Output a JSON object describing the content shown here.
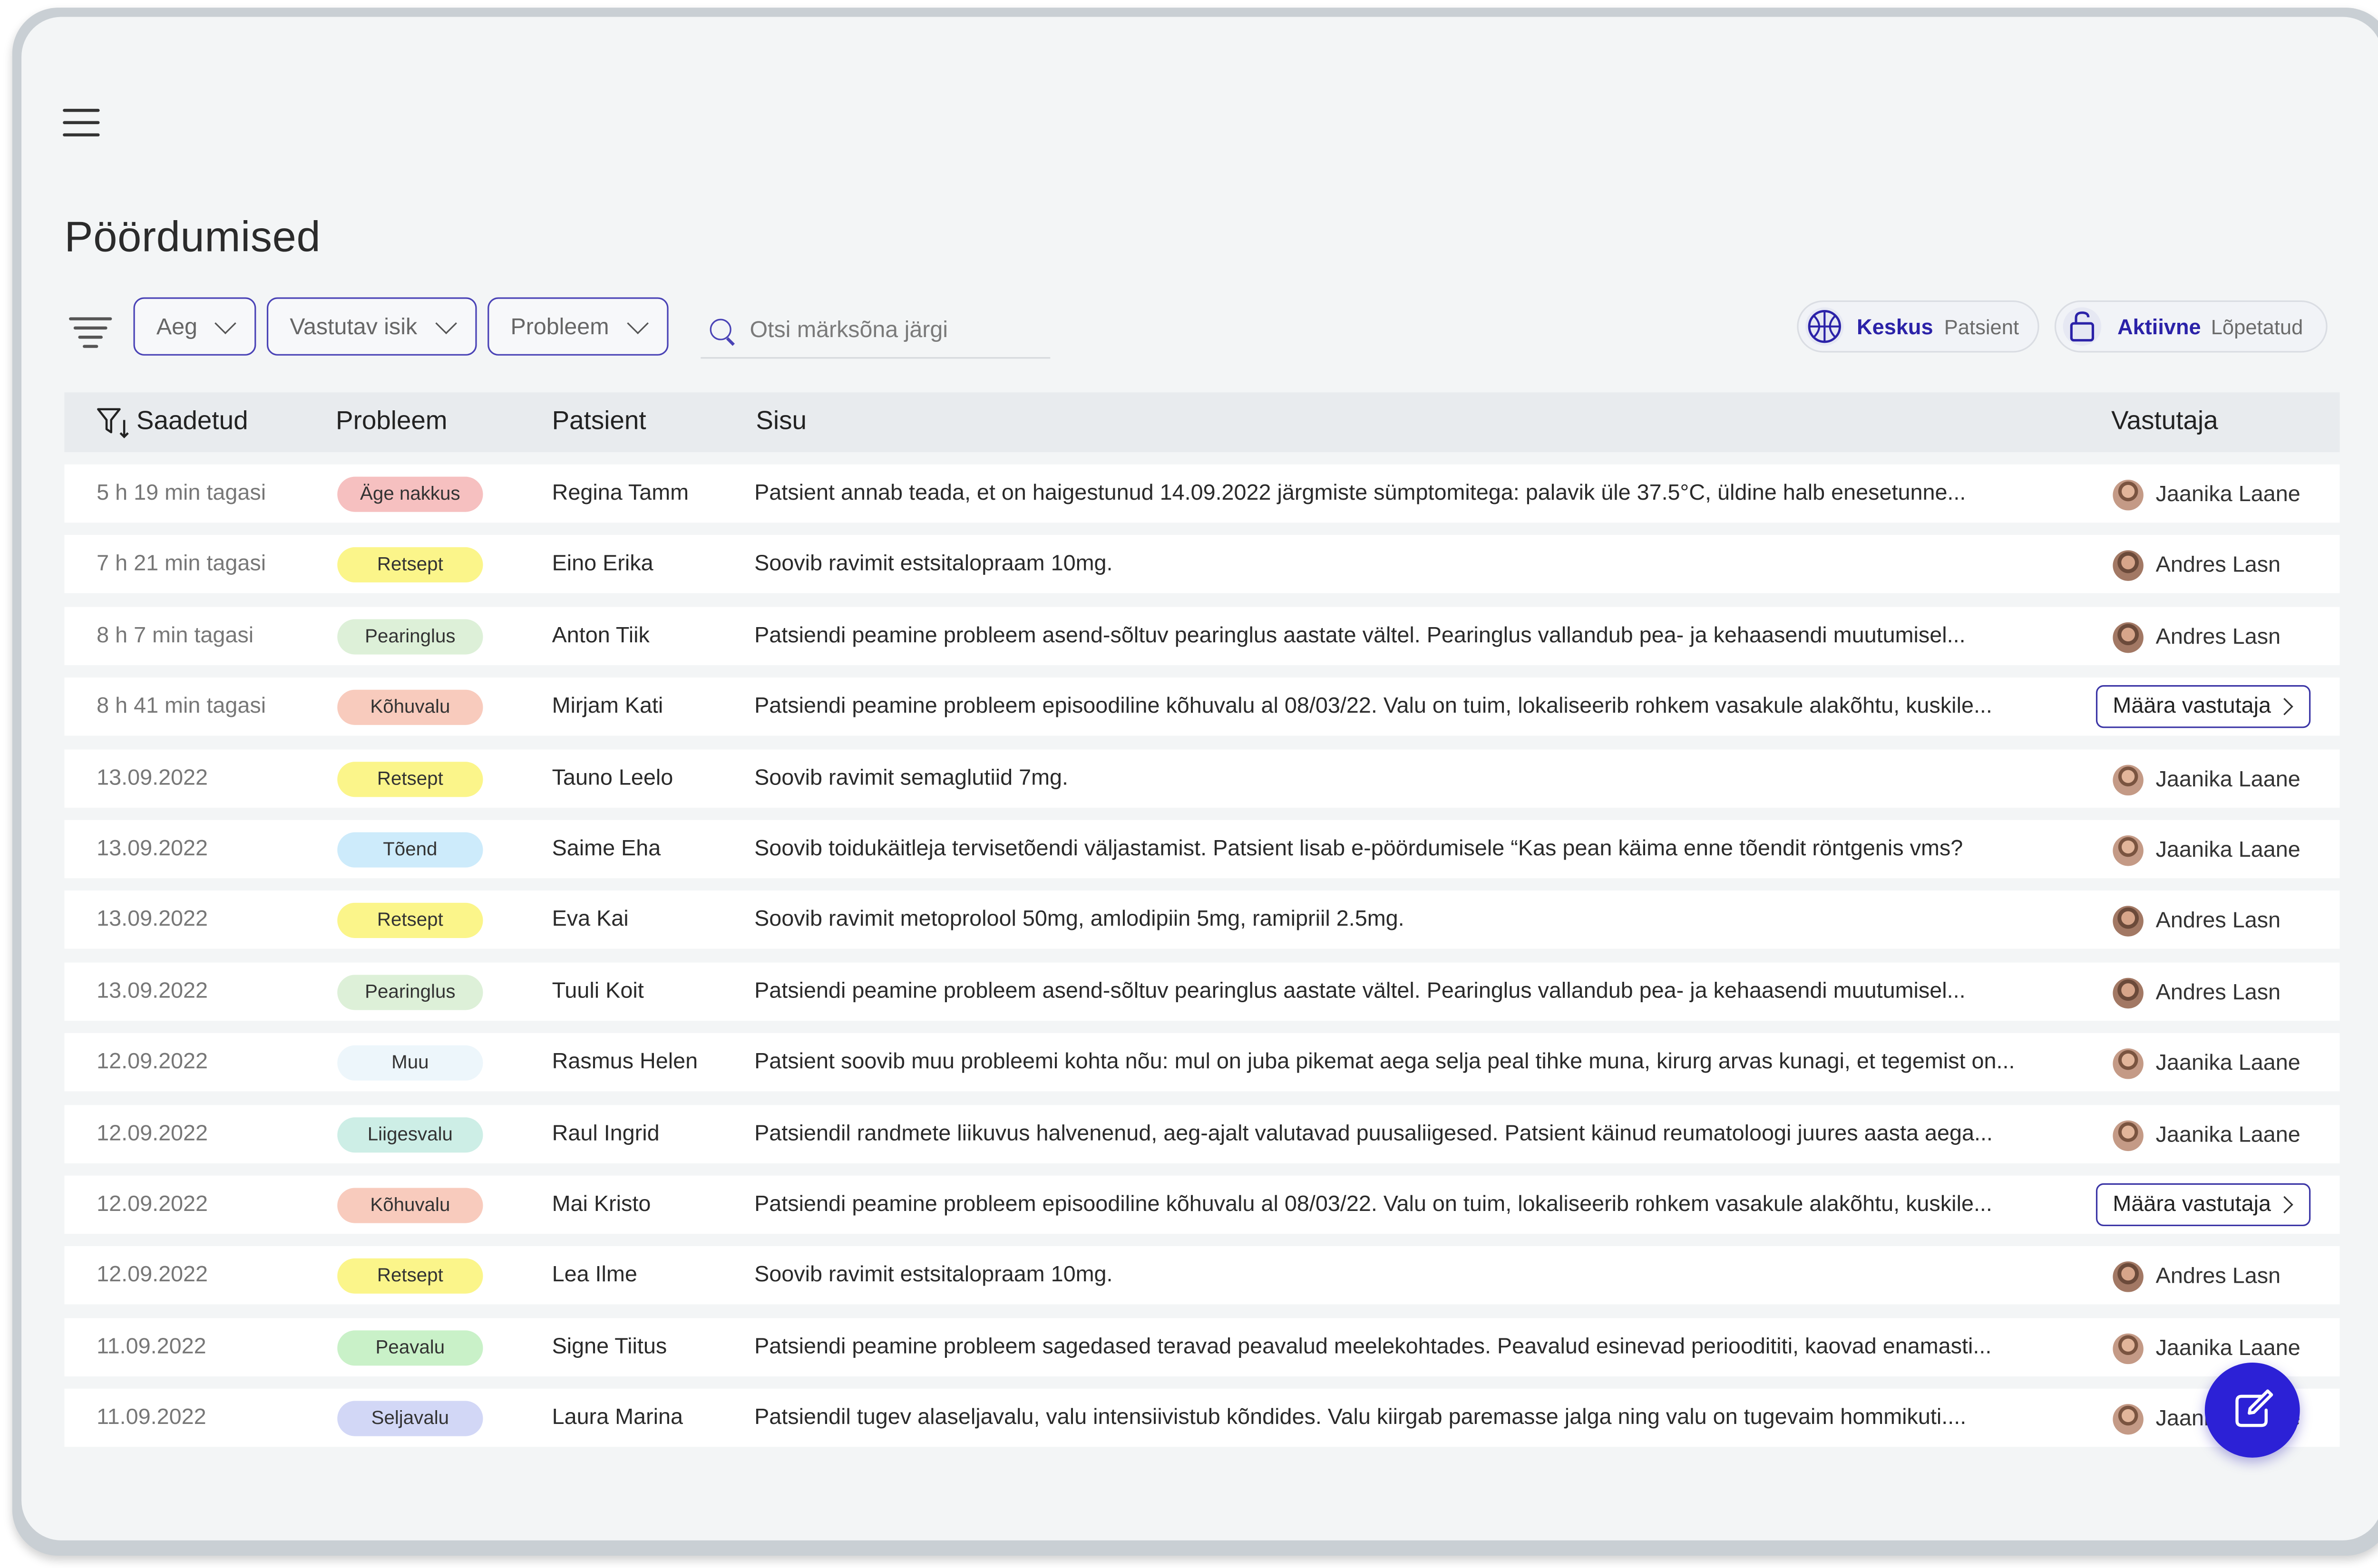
{
  "page": {
    "title": "Pöördumised"
  },
  "filters": {
    "time_label": "Aeg",
    "responsible_label": "Vastutav isik",
    "problem_label": "Probleem",
    "search_placeholder": "Otsi märksõna järgi"
  },
  "toggles": {
    "center": {
      "active": "Keskus",
      "inactive": "Patsient"
    },
    "status": {
      "active": "Aktiivne",
      "inactive": "Lõpetatud"
    }
  },
  "table": {
    "columns": {
      "sent": "Saadetud",
      "problem": "Probleem",
      "patient": "Patsient",
      "content": "Sisu",
      "responsible": "Vastutaja"
    },
    "assign_label": "Määra vastutaja",
    "rows": [
      {
        "date": "5 h 19 min tagasi",
        "problem": "Äge nakkus",
        "patient": "Regina Tamm",
        "content": "Patsient annab teada, et on haigestunud 14.09.2022 järgmiste sümptomitega: palavik üle 37.5°C, üldine halb enesetunne...",
        "responsible": "Jaanika Laane"
      },
      {
        "date": "7 h 21 min  tagasi",
        "problem": "Retsept",
        "patient": "Eino Erika",
        "content": "Soovib ravimit estsitalopraam 10mg.",
        "responsible": "Andres Lasn"
      },
      {
        "date": "8 h 7 min  tagasi",
        "problem": "Pearinglus",
        "patient": "Anton Tiik",
        "content": "Patsiendi peamine probleem asend-sõltuv pearinglus aastate vältel. Pearinglus vallandub pea- ja kehaasendi muutumisel...",
        "responsible": "Andres Lasn"
      },
      {
        "date": "8 h 41 min  tagasi",
        "problem": "Kõhuvalu",
        "patient": "Mirjam Kati",
        "content": "Patsiendi peamine probleem episoodiline kõhuvalu al 08/03/22. Valu on tuim, lokaliseerib rohkem vasakule alakõhtu, kuskile...",
        "responsible": ""
      },
      {
        "date": "13.09.2022",
        "problem": "Retsept",
        "patient": "Tauno Leelo",
        "content": "Soovib ravimit semaglutiid 7mg.",
        "responsible": "Jaanika Laane"
      },
      {
        "date": "13.09.2022",
        "problem": "Tõend",
        "patient": "Saime Eha",
        "content": "Soovib toidukäitleja tervisetõendi väljastamist. Patsient lisab e-pöördumisele “Kas pean käima enne tõendit röntgenis vms?",
        "responsible": "Jaanika Laane"
      },
      {
        "date": "13.09.2022",
        "problem": "Retsept",
        "patient": "Eva Kai",
        "content": "Soovib ravimit metoprolool 50mg, amlodipiin 5mg, ramipriil 2.5mg.",
        "responsible": "Andres Lasn"
      },
      {
        "date": "13.09.2022",
        "problem": "Pearinglus",
        "patient": "Tuuli Koit",
        "content": "Patsiendi peamine probleem asend-sõltuv pearinglus aastate vältel. Pearinglus vallandub pea- ja kehaasendi muutumisel...",
        "responsible": "Andres Lasn"
      },
      {
        "date": "12.09.2022",
        "problem": "Muu",
        "patient": "Rasmus Helen",
        "content": "Patsient soovib muu probleemi kohta nõu: mul on juba pikemat aega selja peal tihke muna, kirurg arvas kunagi, et tegemist on...",
        "responsible": "Jaanika Laane"
      },
      {
        "date": "12.09.2022",
        "problem": "Liigesvalu",
        "patient": "Raul Ingrid",
        "content": "Patsiendil randmete liikuvus halvenenud, aeg-ajalt valutavad puusaliigesed. Patsient käinud reumatoloogi juures aasta aega...",
        "responsible": "Jaanika Laane"
      },
      {
        "date": "12.09.2022",
        "problem": "Kõhuvalu",
        "patient": "Mai Kristo",
        "content": "Patsiendi peamine probleem episoodiline kõhuvalu al 08/03/22. Valu on tuim, lokaliseerib rohkem vasakule alakõhtu, kuskile...",
        "responsible": ""
      },
      {
        "date": "12.09.2022",
        "problem": "Retsept",
        "patient": "Lea Ilme",
        "content": "Soovib ravimit estsitalopraam 10mg.",
        "responsible": "Andres Lasn"
      },
      {
        "date": "11.09.2022",
        "problem": "Peavalu",
        "patient": "Signe Tiitus",
        "content": "Patsiendi peamine probleem sagedased teravad peavalud meelekohtades. Peavalud esinevad perioodititi, kaovad enamasti...",
        "responsible": "Jaanika Laane"
      },
      {
        "date": "11.09.2022",
        "problem": "Seljavalu",
        "patient": "Laura Marina",
        "content": "Patsiendil tugev alaseljavalu, valu intensiivistub kõndides. Valu kiirgab paremasse jalga ning valu on tugevaim hommikuti....",
        "responsible": "Jaanika Laane"
      }
    ]
  },
  "colors": {
    "accent": "#2c21d6",
    "accent_dark": "#2b22a8",
    "badges": {
      "Äge nakkus": "#f6c0c0",
      "Retsept": "#fbf58a",
      "Pearinglus": "#ddf0d8",
      "Kõhuvalu": "#f8cbbd",
      "Tõend": "#cdebfb",
      "Muu": "#edf6fb",
      "Liigesvalu": "#cdeee6",
      "Peavalu": "#c9f1c8",
      "Seljavalu": "#d2d7f6"
    }
  },
  "icons": {
    "menu": "hamburger-icon",
    "filter": "filter-lines-icon",
    "sort": "funnel-sort-down-icon",
    "search": "search-icon",
    "center": "basketball-icon",
    "status": "lock-open-icon",
    "fab": "edit-pencil-icon"
  }
}
